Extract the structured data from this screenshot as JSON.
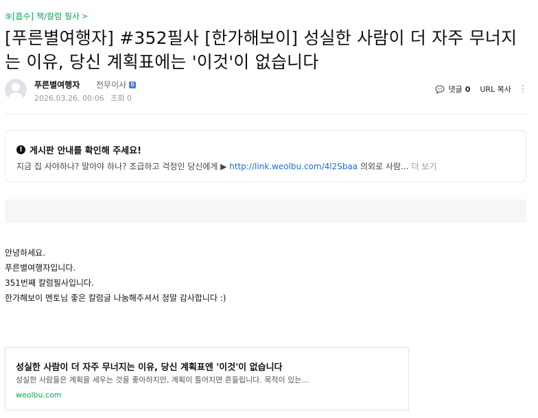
{
  "board": {
    "category": "⑨[흡수] 책/칼럼 필사",
    "category_chevron": ">"
  },
  "post": {
    "title": "[푸른별여행자] #352필사 [한가해보이] 성실한 사람이 더 자주 무너지는 이유, 당신 계획표에는 '이것'이 없습니다",
    "author": "푸른별여행자",
    "rank": "전무이사",
    "rank_badge": "B",
    "date": "2026.03.26. 00:06",
    "views": "조회 0"
  },
  "actions": {
    "comment_label": "댓글",
    "comment_count": "0",
    "url_copy": "URL 복사",
    "more": "⋮"
  },
  "notice": {
    "title": "게시판 안내를 확인해 주세요!",
    "body_prefix": "지금 집 사야하나? 말아야 하나? 조급하고 걱정인 당신에게 ▶ ",
    "link": "http://link.weolbu.com/4l2Sbaa",
    "body_suffix": " 의외로 사람...",
    "more_label": "더 보기"
  },
  "content": {
    "lines": [
      "안녕하세요.",
      "푸른별여행자입니다.",
      "351번째 칼럼필사입니다.",
      "한가해보이 멘토님 좋은 칼럼글 나눔해주셔서 정말 감사합니다 :)"
    ]
  },
  "og_card": {
    "title": "성실한 사람이 더 자주 무너지는 이유, 당신 계획표엔 '이것'이 없습니다",
    "description": "성실한 사람들은 계획을 세우는 것을 좋아하지만, 계획이 틀어지면 흔들립니다. 목적이 있는...",
    "domain": "weolbu.com"
  },
  "colors": {
    "accent_green": "#03a94d",
    "link_blue": "#1c6ed6"
  }
}
